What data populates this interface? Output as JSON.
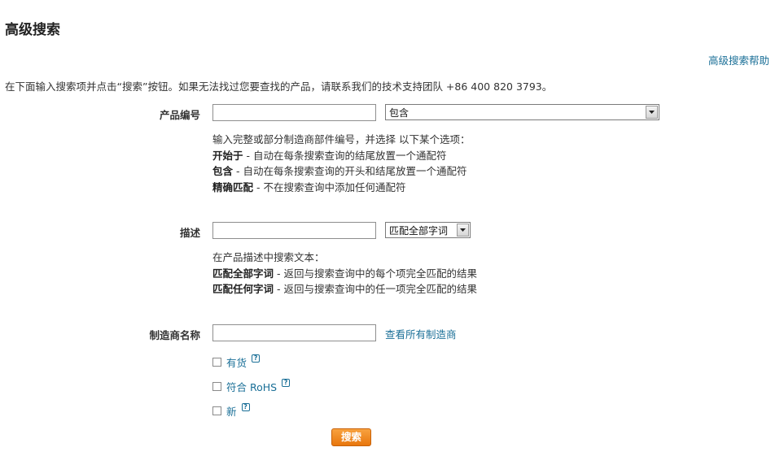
{
  "page": {
    "title": "高级搜索",
    "help_link": "高级搜索帮助",
    "intro": "在下面输入搜索项并点击“搜索”按钮。如果无法找过您要查找的产品，请联系我们的技术支持团队 +86 400 820 3793。"
  },
  "part_number": {
    "label": "产品编号",
    "value": "",
    "mode_selected": "包含",
    "hint_intro": "输入完整或部分制造商部件编号，并选择 以下某个选项：",
    "options": [
      {
        "name": "开始于",
        "desc": " - 自动在每条搜索查询的结尾放置一个通配符"
      },
      {
        "name": "包含",
        "desc": " - 自动在每条搜索查询的开头和结尾放置一个通配符"
      },
      {
        "name": "精确匹配",
        "desc": " - 不在搜索查询中添加任何通配符"
      }
    ]
  },
  "description": {
    "label": "描述",
    "value": "",
    "mode_selected": "匹配全部字词",
    "hint_intro": "在产品描述中搜索文本：",
    "options": [
      {
        "name": "匹配全部字词",
        "desc": " - 返回与搜索查询中的每个项完全匹配的结果"
      },
      {
        "name": "匹配任何字词",
        "desc": " - 返回与搜索查询中的任一项完全匹配的结果"
      }
    ]
  },
  "manufacturer": {
    "label": "制造商名称",
    "value": "",
    "view_all_link": "查看所有制造商"
  },
  "filters": [
    {
      "label": "有货",
      "checked": false,
      "help_icon": "?"
    },
    {
      "label": "符合 RoHS",
      "checked": false,
      "help_icon": "?"
    },
    {
      "label": "新",
      "checked": false,
      "help_icon": "?"
    }
  ],
  "search_button": "搜索",
  "colors": {
    "link": "#1a6f97",
    "button": "#e8760d"
  }
}
